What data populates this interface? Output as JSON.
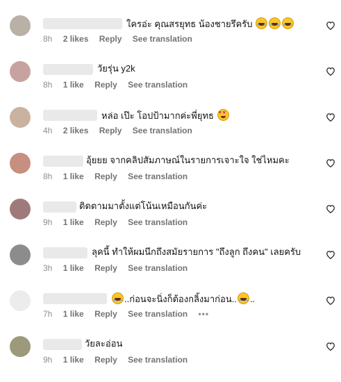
{
  "colors": {
    "meta": "#8e8e8e",
    "text": "#111111",
    "blur": "#e9e9e9"
  },
  "comments": [
    {
      "text": "ใครอ่ะ คุณสรยุทธ น้องชายรึครับ",
      "emoji": "laugh-emoji",
      "time": "8h",
      "likes": "2 likes",
      "reply": "Reply",
      "translate": "See translation",
      "avatar_color": "#b9b1a6"
    },
    {
      "text": "วัยรุ่น y2k",
      "time": "8h",
      "likes": "1 like",
      "reply": "Reply",
      "translate": "See translation",
      "avatar_color": "#c7a3a0"
    },
    {
      "text": "หล่อ เป๊ะ โอปป้ามากค่ะพี่ยุทธ",
      "emoji": "heart-eyes-emoji",
      "time": "4h",
      "likes": "2 likes",
      "reply": "Reply",
      "translate": "See translation",
      "avatar_color": "#c9b3a0"
    },
    {
      "text": "อุ้ยยย จากคลิปสัมภาษณ์ในรายการเจาะใจ ใช่ไหมคะ",
      "time": "8h",
      "likes": "1 like",
      "reply": "Reply",
      "translate": "See translation",
      "avatar_color": "#c68f7f"
    },
    {
      "text": "ติดตามมาตั้งแต่โน้นเหมือนกันค่ะ",
      "time": "9h",
      "likes": "1 like",
      "reply": "Reply",
      "translate": "See translation",
      "avatar_color": "#a07a7a"
    },
    {
      "text": "ลุคนี้ ทำให้ผมนึกถึงสมัยรายการ \"ถึงลูก ถึงคน\" เลยครับ",
      "time": "3h",
      "likes": "1 like",
      "reply": "Reply",
      "translate": "See translation",
      "avatar_color": "#8c8c8c"
    },
    {
      "text": "..ก่อนจะนิ่งก็ต้องกลิ้งมาก่อน..",
      "trail": "..",
      "time": "7h",
      "likes": "1 like",
      "reply": "Reply",
      "translate": "See translation",
      "more": "•••",
      "avatar_color": "#ececec"
    },
    {
      "text": "วัยละอ่อน",
      "time": "9h",
      "likes": "1 like",
      "reply": "Reply",
      "translate": "See translation",
      "avatar_color": "#9c9a7a"
    }
  ]
}
